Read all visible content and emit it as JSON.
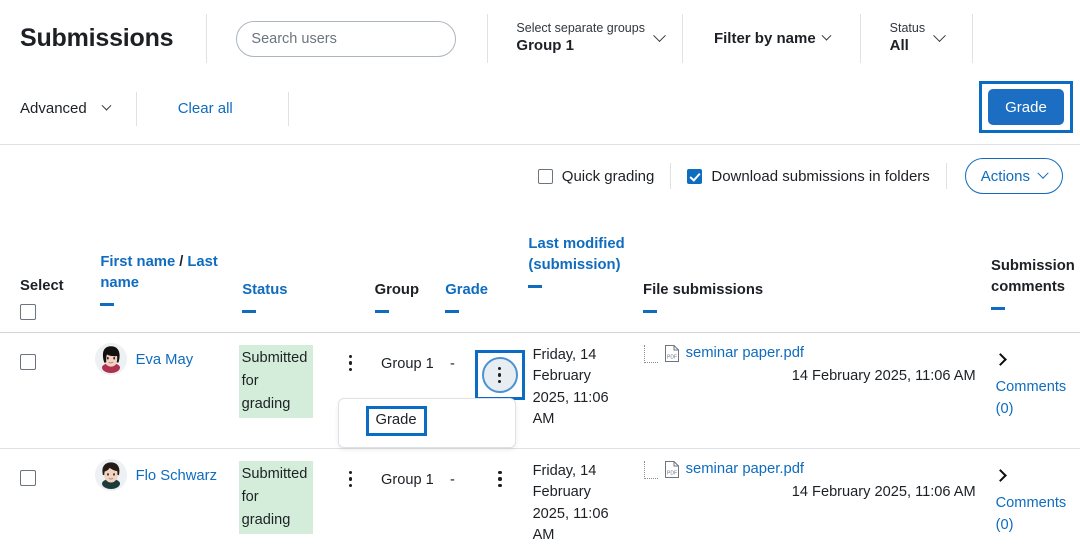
{
  "header": {
    "title": "Submissions",
    "search": {
      "placeholder": "Search users",
      "value": ""
    },
    "group_filter": {
      "label": "Select separate groups",
      "value": "Group 1",
      "chevron": "chevron-down-icon"
    },
    "name_filter": {
      "label": "Filter by name",
      "chevron": "chevron-down-icon"
    },
    "status_filter": {
      "label": "Status",
      "value": "All",
      "chevron": "chevron-down-icon"
    }
  },
  "toolbar": {
    "advanced_label": "Advanced",
    "clear_all_label": "Clear all",
    "grade_button": "Grade",
    "grade_button_focused": true
  },
  "options": {
    "quick_grading": {
      "label": "Quick grading",
      "checked": false
    },
    "download_in_folders": {
      "label": "Download submissions in folders",
      "checked": true
    },
    "actions_button": "Actions"
  },
  "table": {
    "headers": {
      "select": "Select",
      "first_name": "First name",
      "slash": "/",
      "last_name": "Last name",
      "status": "Status",
      "group": "Group",
      "grade": "Grade",
      "last_modified": "Last modified (submission)",
      "file_submissions": "File submissions",
      "submission_comments": "Submission comments"
    },
    "rows": [
      {
        "selected": false,
        "name": "Eva May",
        "avatar": "avatar-eva",
        "status": "Submitted for grading",
        "group": "Group 1",
        "grade": "-",
        "last_modified": "Friday, 14 February 2025, 11:06 AM",
        "file_name": "seminar paper.pdf",
        "file_date": "14 February 2025, 11:06 AM",
        "comments_label": "Comments (0)",
        "menu_open": true,
        "menu_items": [
          "Grade"
        ]
      },
      {
        "selected": false,
        "name": "Flo Schwarz",
        "avatar": "avatar-flo",
        "status": "Submitted for grading",
        "group": "Group 1",
        "grade": "-",
        "last_modified": "Friday, 14 February 2025, 11:06 AM",
        "file_name": "seminar paper.pdf",
        "file_date": "14 February 2025, 11:06 AM",
        "comments_label": "Comments (0)",
        "menu_open": false,
        "menu_items": []
      }
    ]
  },
  "colors": {
    "link": "#0f6cbf",
    "primary_button": "#1b6ec2",
    "focus_outline": "#0b6cc4",
    "status_background": "#d4edda",
    "border": "#dee2e6"
  }
}
